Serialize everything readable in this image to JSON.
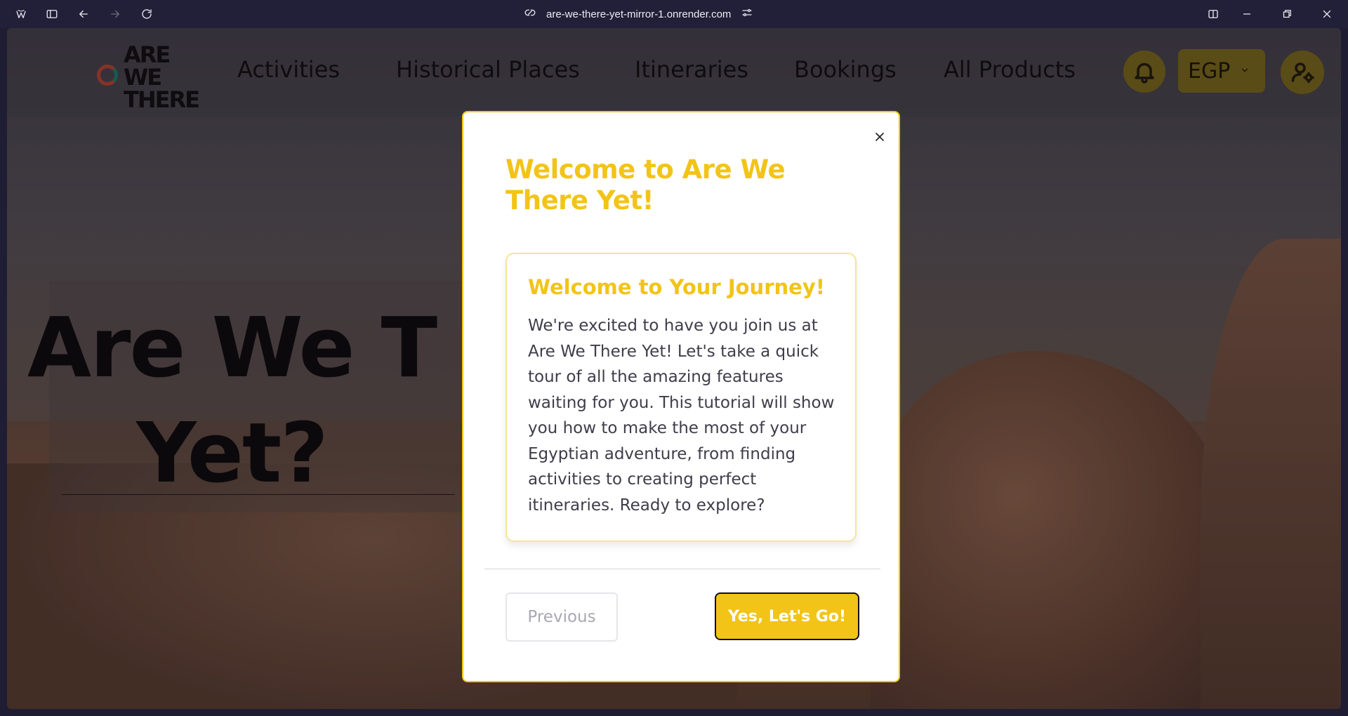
{
  "browser": {
    "url": "are-we-there-yet-mirror-1.onrender.com"
  },
  "navbar": {
    "logo_text": "ARE WE THERE",
    "items": [
      "Activities",
      "Historical Places",
      "Itineraries",
      "Bookings",
      "All Products"
    ],
    "currency": "EGP"
  },
  "hero": {
    "title_line1": "Are We T",
    "title_line2": "Yet?"
  },
  "modal": {
    "title": "Welcome to Are We There Yet!",
    "card_title": "Welcome to Your Journey!",
    "card_body": "We're excited to have you join us at Are We There Yet! Let's take a quick tour of all the amazing features waiting for you. This tutorial will show you how to make the most of your Egyptian adventure, from finding activities to creating perfect itineraries. Ready to explore?",
    "previous_label": "Previous",
    "confirm_label": "Yes, Let's Go!"
  },
  "colors": {
    "accent": "#f2c418",
    "background": "#221f38"
  }
}
